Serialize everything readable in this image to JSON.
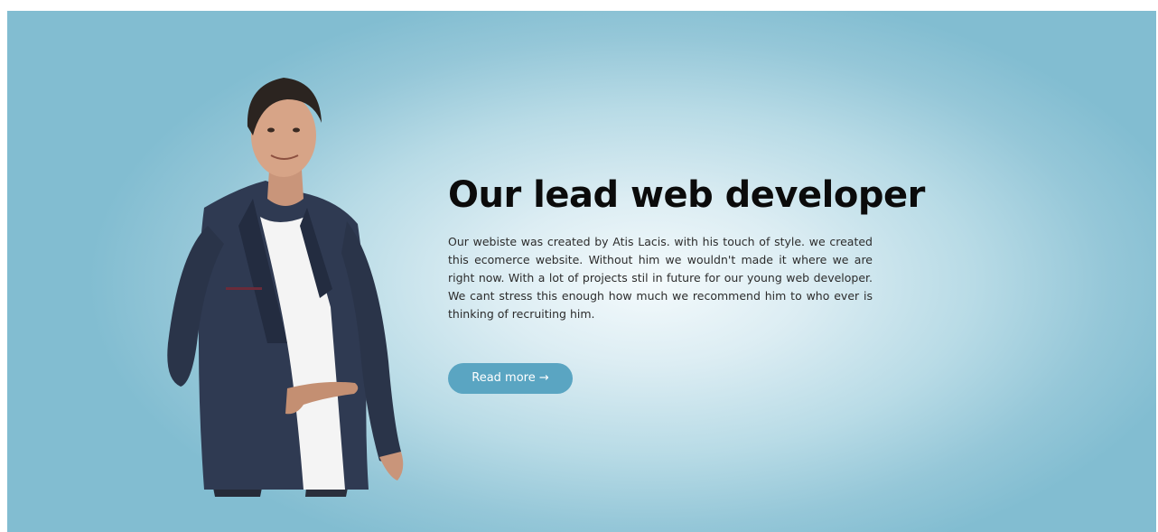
{
  "hero": {
    "title": "Our lead web developer",
    "description": "Our webiste was created by Atis Lacis. with his touch of style. we created this ecomerce website. Without him we wouldn't made it where we are right now. With a lot of projects stil in future for our young web developer. We cant stress this enough how much we recommend him to who ever is thinking of recruiting him.",
    "button_label": "Read more →",
    "accent_color": "#5aa5c2"
  }
}
